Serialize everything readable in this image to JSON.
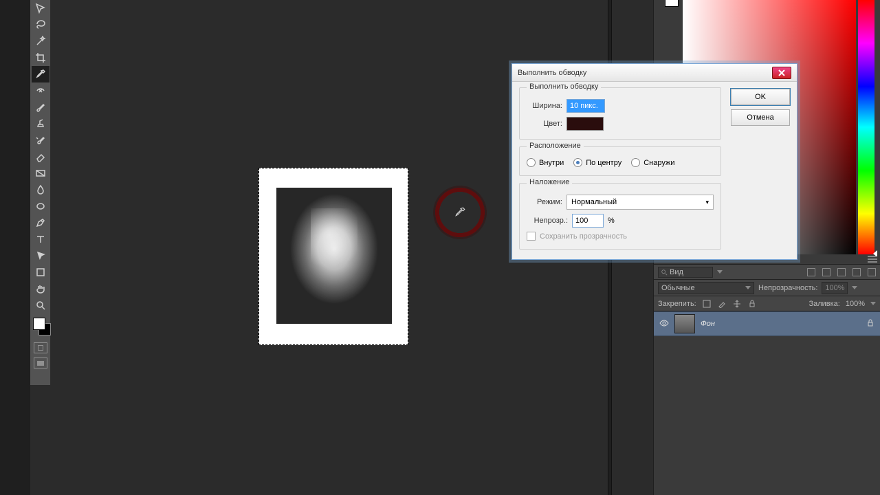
{
  "dialog": {
    "title": "Выполнить обводку",
    "group_stroke": {
      "legend": "Выполнить обводку",
      "width_label": "Ширина:",
      "width_value": "10 пикс.",
      "color_label": "Цвет:",
      "color_value": "#2a0d0d"
    },
    "group_position": {
      "legend": "Расположение",
      "options": [
        "Внутри",
        "По центру",
        "Снаружи"
      ],
      "selected_index": 1
    },
    "group_blend": {
      "legend": "Наложение",
      "mode_label": "Режим:",
      "mode_value": "Нормальный",
      "opacity_label": "Непрозр.:",
      "opacity_value": "100",
      "opacity_suffix": "%",
      "preserve_label": "Сохранить прозрачность",
      "preserve_checked": false
    },
    "buttons": {
      "ok": "OK",
      "cancel": "Отмена"
    }
  },
  "panels": {
    "view_label": "Вид",
    "blend_mode": "Обычные",
    "opacity_label": "Непрозрачность:",
    "opacity_value": "100%",
    "lock_label": "Закрепить:",
    "fill_label": "Заливка:",
    "fill_value": "100%"
  },
  "layers": [
    {
      "name": "Фон",
      "locked": true,
      "visible": true
    }
  ],
  "tools": [
    "move-tool",
    "lasso-tool",
    "magic-wand-tool",
    "crop-tool",
    "eyedropper-tool",
    "spot-heal-tool",
    "brush-tool",
    "clone-stamp-tool",
    "history-brush-tool",
    "eraser-tool",
    "gradient-tool",
    "blur-tool",
    "dodge-tool",
    "pen-tool",
    "type-tool",
    "path-select-tool",
    "shape-tool",
    "hand-tool",
    "zoom-tool"
  ],
  "selected_tool_index": 4
}
